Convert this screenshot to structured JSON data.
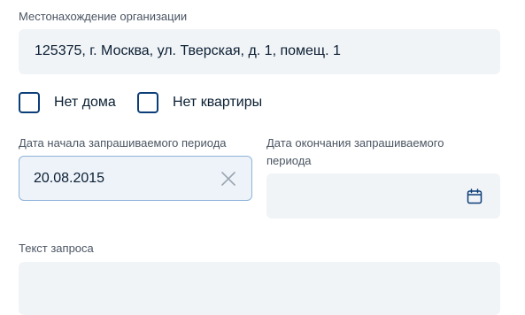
{
  "location": {
    "label": "Местонахождение организации",
    "value": "125375, г. Москва, ул. Тверская, д. 1, помещ. 1"
  },
  "checkboxes": [
    {
      "label": "Нет дома",
      "checked": false
    },
    {
      "label": "Нет квартиры",
      "checked": false
    }
  ],
  "period_start": {
    "label": "Дата начала запрашиваемого периода",
    "value": "20.08.2015"
  },
  "period_end": {
    "label_line1": "Дата окончания запрашиваемого",
    "label_line2": "периода",
    "value": ""
  },
  "request_text": {
    "label": "Текст запроса",
    "value": ""
  },
  "colors": {
    "field_bg": "#f1f4f7",
    "checkbox_border": "#0b3d78",
    "active_border": "#8fb3d9",
    "icon": "#0b3d78"
  }
}
